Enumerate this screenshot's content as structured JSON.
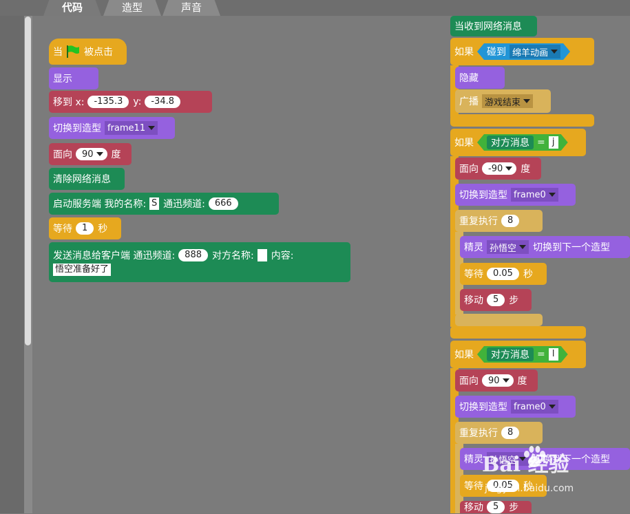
{
  "tabs": [
    {
      "label": "代码",
      "active": true
    },
    {
      "label": "造型",
      "active": false
    },
    {
      "label": "声音",
      "active": false
    }
  ],
  "left_script": {
    "when_flag_clicked": {
      "pre": "当",
      "post": "被点击"
    },
    "show": "显示",
    "goto": {
      "label": "移到 x:",
      "x": "-135.3",
      "y_label": "y:",
      "y": "-34.8"
    },
    "switch_costume": {
      "label": "切换到造型",
      "value": "frame11"
    },
    "point_direction": {
      "label": "面向",
      "value": "90",
      "unit": "度"
    },
    "clear_messages": "清除网络消息",
    "start_server": {
      "label": "启动服务端 我的名称:",
      "name": "S",
      "channel_label": "通迅频道:",
      "channel": "666"
    },
    "wait": {
      "label": "等待",
      "value": "1",
      "unit": "秒"
    },
    "send_message": {
      "label": "发送消息给客户端 通迅频道:",
      "channel": "888",
      "target_label": "对方名称:",
      "target": "",
      "content_label": "内容:",
      "content": "悟空准备好了"
    }
  },
  "right_script": {
    "hat": "当收到网络消息",
    "if1": {
      "label": "如果",
      "touching_label": "碰到",
      "touching_value": "绵羊动画"
    },
    "hide": "隐藏",
    "broadcast": {
      "label": "广播",
      "value": "游戏结束"
    },
    "if2": {
      "label": "如果",
      "msg_label": "对方消息",
      "eq": "=",
      "value": "j"
    },
    "face1": {
      "label": "面向",
      "value": "-90",
      "unit": "度"
    },
    "costume1": {
      "label": "切换到造型",
      "value": "frame0"
    },
    "repeat1": {
      "label": "重复执行",
      "value": "8"
    },
    "sprite1": {
      "label": "精灵",
      "sprite": "孙悟空",
      "action": "切换到下一个造型"
    },
    "wait1": {
      "label": "等待",
      "value": "0.05",
      "unit": "秒"
    },
    "move1": {
      "label": "移动",
      "value": "5",
      "unit": "步"
    },
    "if3": {
      "label": "如果",
      "msg_label": "对方消息",
      "eq": "=",
      "value": "l"
    },
    "face2": {
      "label": "面向",
      "value": "90",
      "unit": "度"
    },
    "costume2": {
      "label": "切换到造型",
      "value": "frame0"
    },
    "repeat2": {
      "label": "重复执行",
      "value": "8"
    },
    "sprite2": {
      "label": "精灵",
      "sprite": "孙悟空",
      "action": "切换到下一个造型"
    },
    "wait2": {
      "label": "等待",
      "value": "0.05",
      "unit": "秒"
    },
    "move2": {
      "label": "移动",
      "value": "5",
      "unit": "步"
    }
  },
  "watermark": {
    "logo": "Bai  经验",
    "url": "jingyan.baidu.com"
  },
  "colors": {
    "control": "#e6a81f",
    "looks": "#9561df",
    "motion": "#b54357",
    "network": "#1d8b55",
    "sensing": "#2295d6",
    "sound": "#d9b35b",
    "operator": "#41b23b"
  }
}
